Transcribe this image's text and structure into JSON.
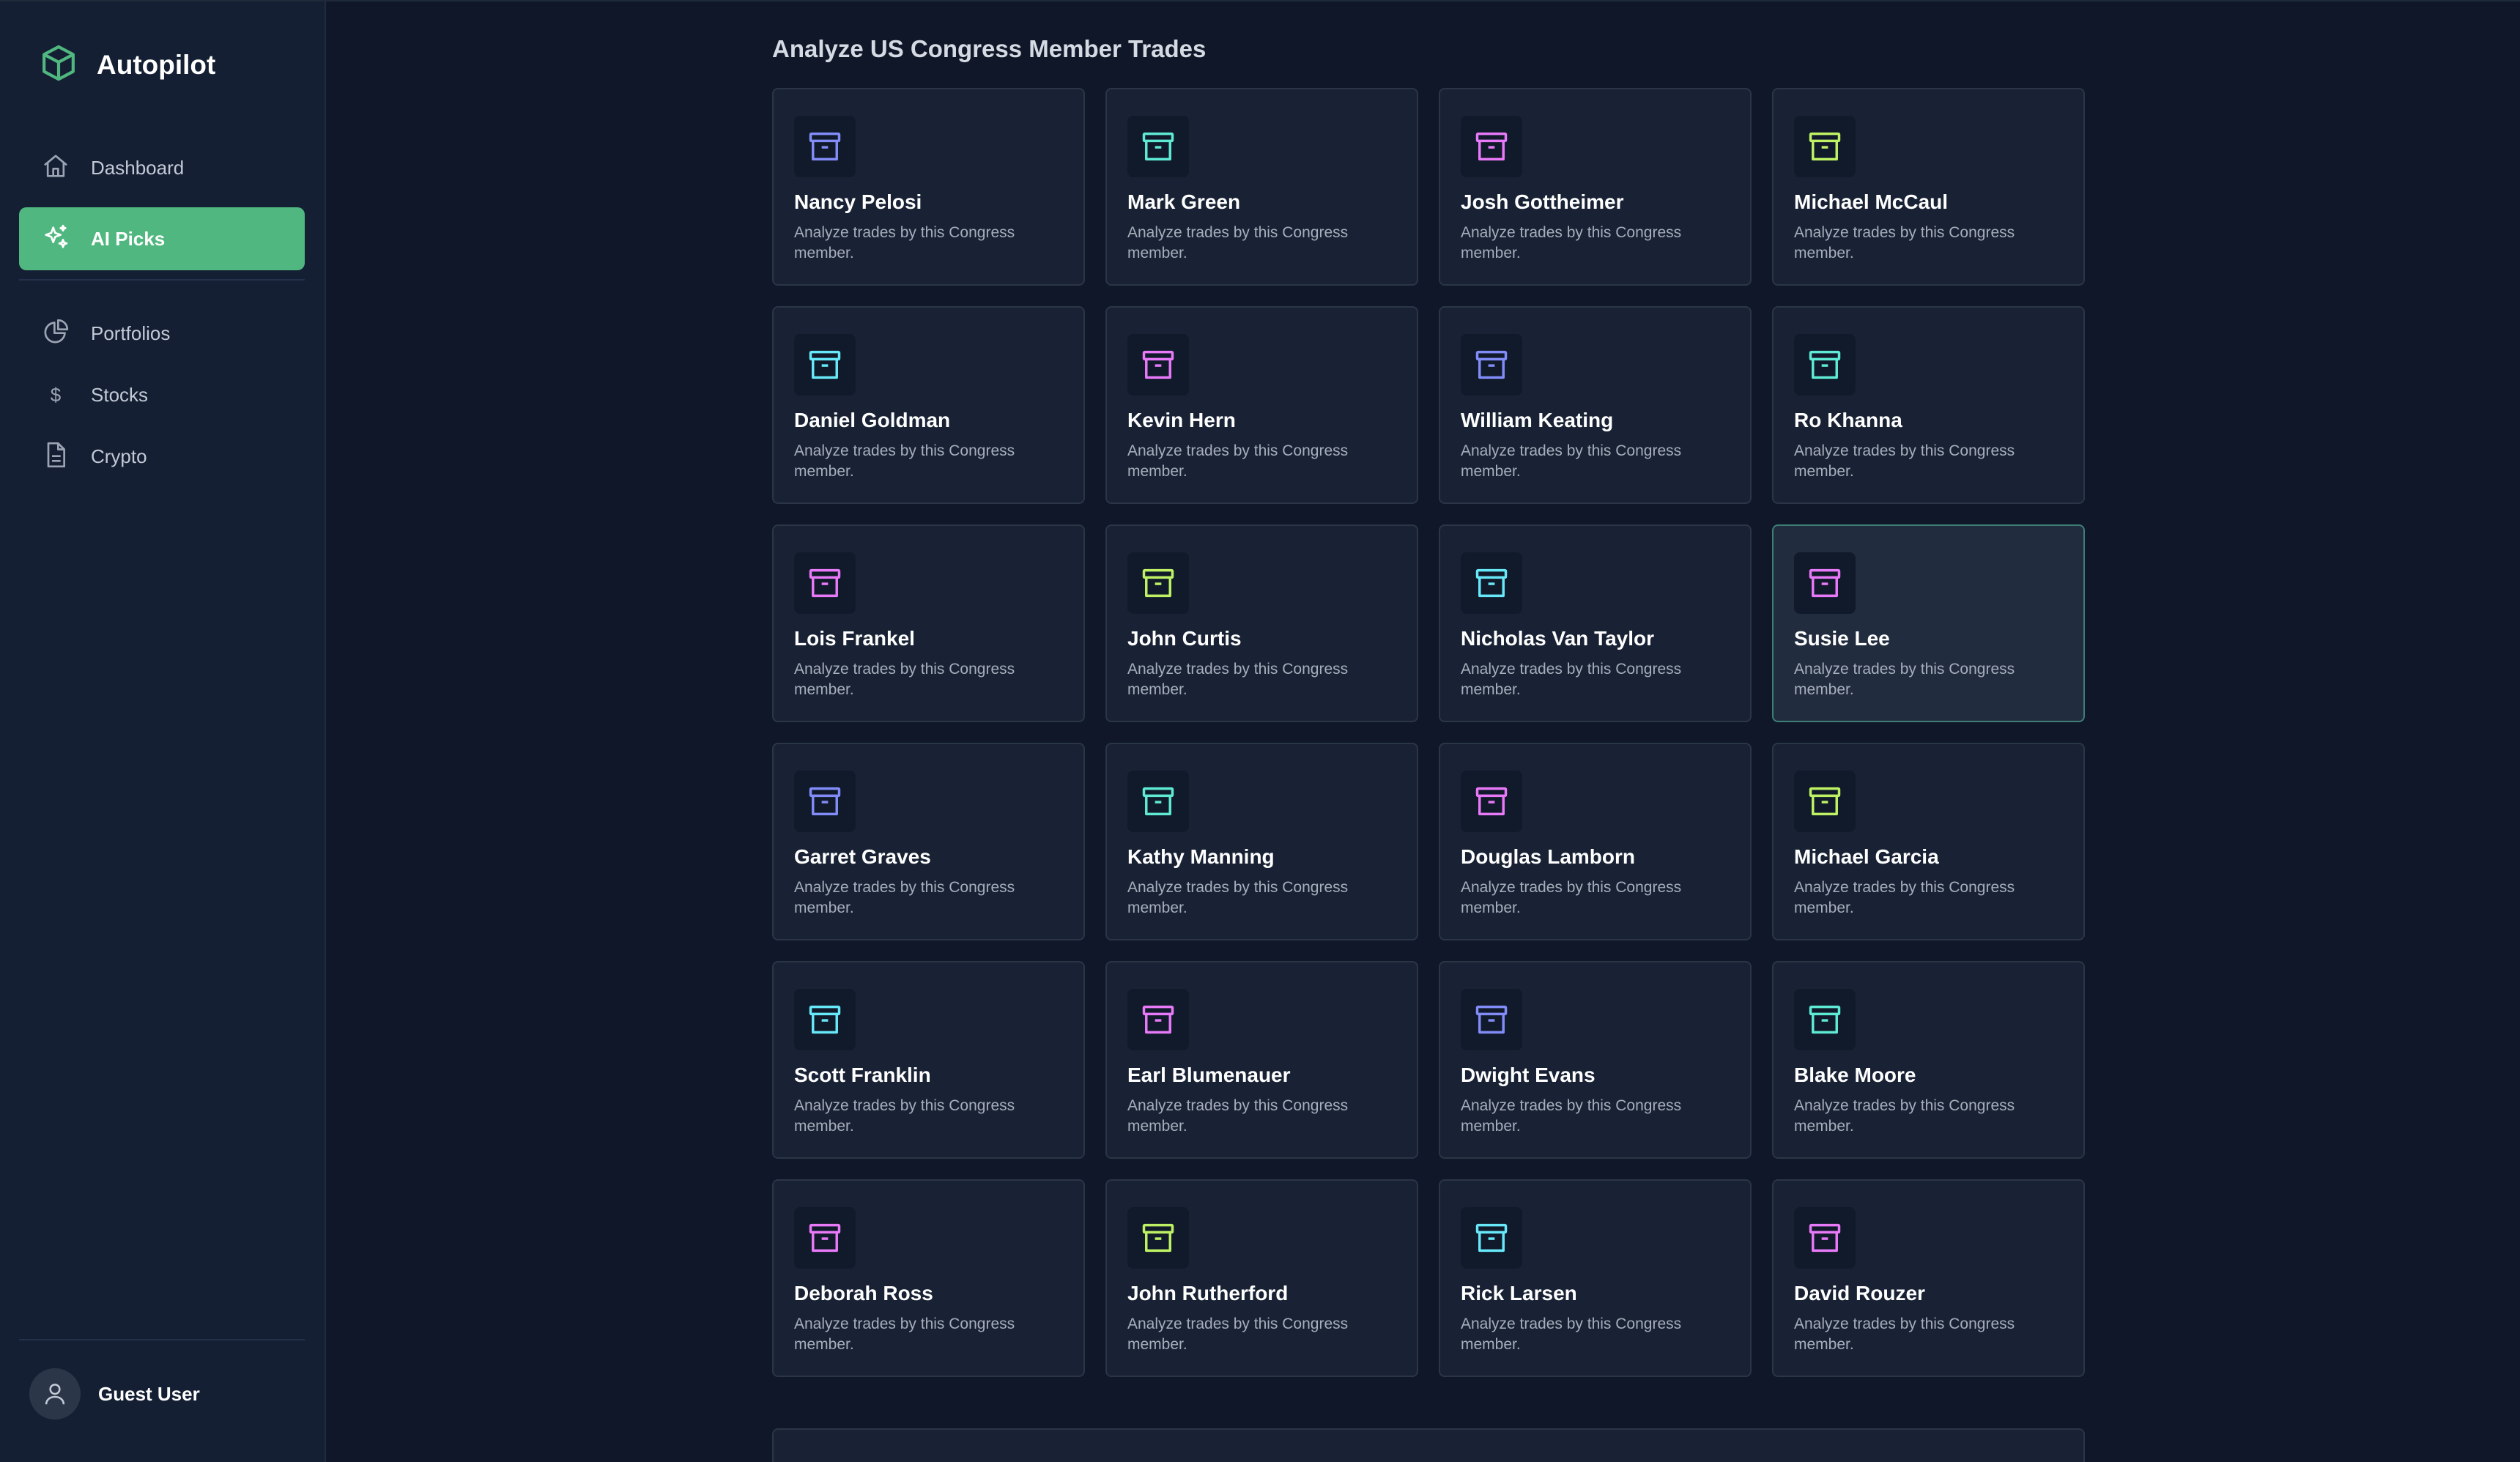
{
  "app": {
    "name": "Autopilot",
    "accent": "#4fb77f"
  },
  "sidebar": {
    "items": [
      {
        "label": "Dashboard",
        "icon": "home-icon"
      },
      {
        "label": "AI Picks",
        "icon": "sparkles-icon",
        "active": true
      },
      {
        "label": "Portfolios",
        "icon": "pie-chart-icon"
      },
      {
        "label": "Stocks",
        "icon": "dollar-icon"
      },
      {
        "label": "Crypto",
        "icon": "document-icon"
      }
    ]
  },
  "user": {
    "name": "Guest User"
  },
  "main": {
    "title": "Analyze US Congress Member Trades",
    "card_description": "Analyze trades by this Congress member.",
    "selected_card": "Susie Lee",
    "icon_colors": {
      "violet": "#818cf8",
      "teal": "#5eead4",
      "pink": "#e879f9",
      "lime": "#bef264",
      "cyan": "#67e8f9"
    },
    "cards": [
      {
        "name": "Nancy Pelosi",
        "icon": "archive-icon",
        "color": "#818cf8"
      },
      {
        "name": "Mark Green",
        "icon": "archive-icon",
        "color": "#5eead4"
      },
      {
        "name": "Josh Gottheimer",
        "icon": "archive-icon",
        "color": "#e879f9"
      },
      {
        "name": "Michael McCaul",
        "icon": "archive-icon",
        "color": "#bef264"
      },
      {
        "name": "Daniel Goldman",
        "icon": "archive-icon",
        "color": "#67e8f9"
      },
      {
        "name": "Kevin Hern",
        "icon": "archive-icon",
        "color": "#e879f9"
      },
      {
        "name": "William Keating",
        "icon": "archive-icon",
        "color": "#818cf8"
      },
      {
        "name": "Ro Khanna",
        "icon": "archive-icon",
        "color": "#5eead4"
      },
      {
        "name": "Lois Frankel",
        "icon": "archive-icon",
        "color": "#e879f9"
      },
      {
        "name": "John Curtis",
        "icon": "archive-icon",
        "color": "#bef264"
      },
      {
        "name": "Nicholas Van Taylor",
        "icon": "archive-icon",
        "color": "#67e8f9"
      },
      {
        "name": "Susie Lee",
        "icon": "archive-icon",
        "color": "#e879f9"
      },
      {
        "name": "Garret Graves",
        "icon": "archive-icon",
        "color": "#818cf8"
      },
      {
        "name": "Kathy Manning",
        "icon": "archive-icon",
        "color": "#5eead4"
      },
      {
        "name": "Douglas Lamborn",
        "icon": "archive-icon",
        "color": "#e879f9"
      },
      {
        "name": "Michael Garcia",
        "icon": "archive-icon",
        "color": "#bef264"
      },
      {
        "name": "Scott Franklin",
        "icon": "archive-icon",
        "color": "#67e8f9"
      },
      {
        "name": "Earl Blumenauer",
        "icon": "archive-icon",
        "color": "#e879f9"
      },
      {
        "name": "Dwight Evans",
        "icon": "archive-icon",
        "color": "#818cf8"
      },
      {
        "name": "Blake Moore",
        "icon": "archive-icon",
        "color": "#5eead4"
      },
      {
        "name": "Deborah Ross",
        "icon": "archive-icon",
        "color": "#e879f9"
      },
      {
        "name": "John Rutherford",
        "icon": "archive-icon",
        "color": "#bef264"
      },
      {
        "name": "Rick Larsen",
        "icon": "archive-icon",
        "color": "#67e8f9"
      },
      {
        "name": "David Rouzer",
        "icon": "archive-icon",
        "color": "#e879f9"
      }
    ]
  }
}
